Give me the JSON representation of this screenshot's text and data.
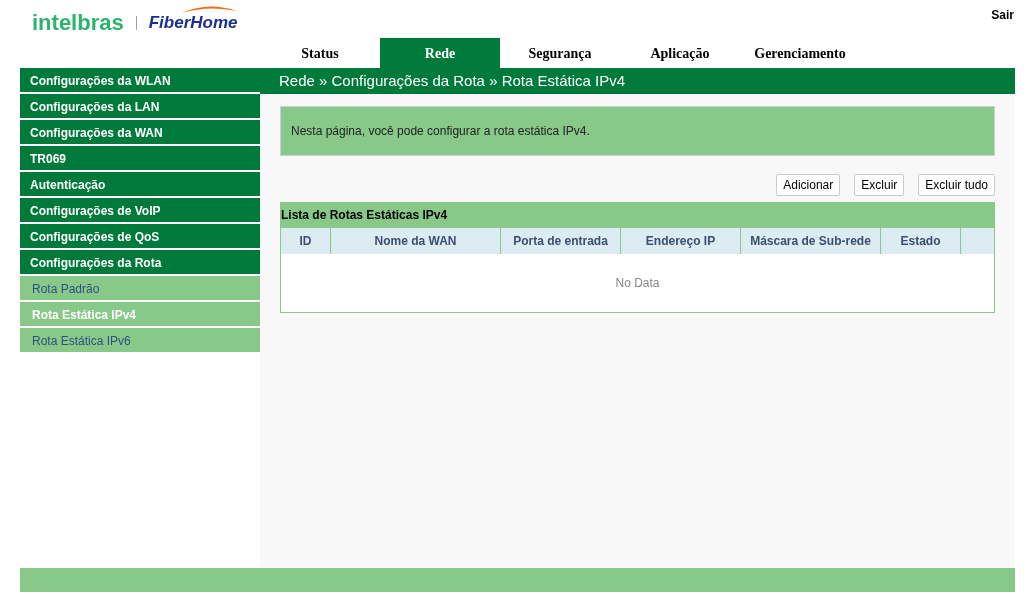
{
  "header": {
    "logo_left": "intelbras",
    "logo_right": "FiberHome",
    "logout": "Sair"
  },
  "tabs": [
    {
      "label": "Status",
      "selected": false
    },
    {
      "label": "Rede",
      "selected": true
    },
    {
      "label": "Segurança",
      "selected": false
    },
    {
      "label": "Aplicação",
      "selected": false
    },
    {
      "label": "Gerenciamento",
      "selected": false
    }
  ],
  "sidebar": {
    "items": [
      {
        "label": "Configurações da WLAN"
      },
      {
        "label": "Configurações da LAN"
      },
      {
        "label": "Configurações da WAN"
      },
      {
        "label": "TR069"
      },
      {
        "label": "Autenticação"
      },
      {
        "label": "Configurações de VoIP"
      },
      {
        "label": "Configurações de QoS"
      },
      {
        "label": "Configurações da Rota",
        "children": [
          {
            "label": "Rota Padrão",
            "selected": false
          },
          {
            "label": "Rota Estática IPv4",
            "selected": true
          },
          {
            "label": "Rota Estática IPv6",
            "selected": false
          }
        ]
      }
    ]
  },
  "breadcrumb": "Rede » Configurações da Rota » Rota Estática IPv4",
  "info": "Nesta página, você pode configurar a rota estática IPv4.",
  "buttons": [
    "Adicionar",
    "Excluir",
    "Excluir tudo"
  ],
  "table": {
    "title": "Lista de Rotas Estáticas IPv4",
    "columns": [
      "ID",
      "Nome da WAN",
      "Porta de entrada",
      "Endereço IP",
      "Máscara de Sub-rede",
      "Estado"
    ],
    "empty_text": "No Data"
  }
}
